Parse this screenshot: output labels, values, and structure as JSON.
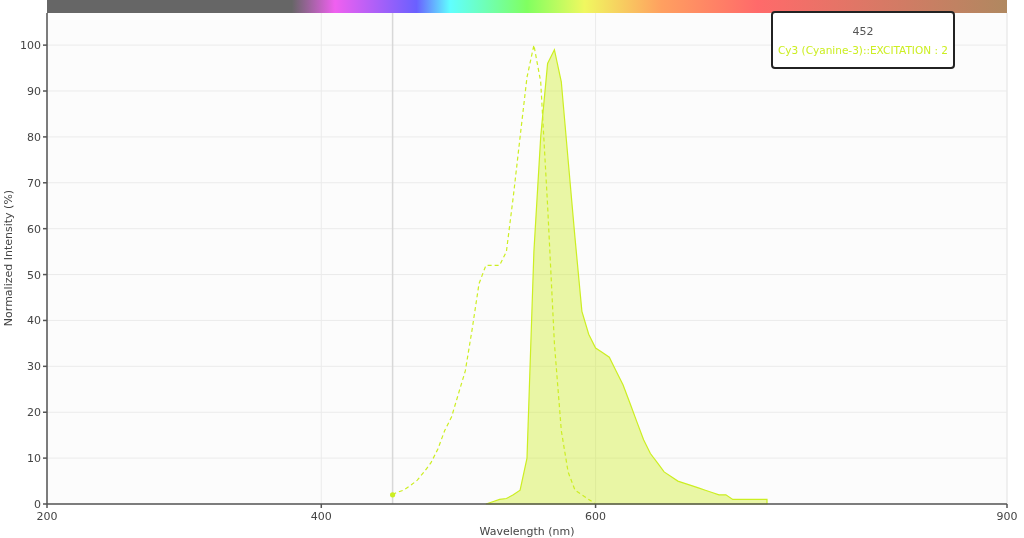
{
  "chart": {
    "chart_data": {
      "type": "area",
      "xlabel": "Wavelength (nm)",
      "ylabel": "Normalized Intensity (%)",
      "xlim": [
        200,
        900
      ],
      "ylim": [
        0,
        107
      ],
      "xticks": [
        200,
        400,
        600,
        900
      ],
      "yticks": [
        0,
        10,
        20,
        30,
        40,
        50,
        60,
        70,
        80,
        90,
        100
      ],
      "grid": true,
      "ref_lines": [
        {
          "axis": "x",
          "value": 452
        }
      ],
      "x": [
        452,
        455,
        460,
        465,
        470,
        475,
        480,
        485,
        490,
        495,
        500,
        505,
        510,
        515,
        520,
        525,
        530,
        535,
        540,
        545,
        550,
        555,
        560,
        565,
        570,
        575,
        580,
        585,
        590,
        595,
        600,
        605,
        610,
        615,
        620,
        625,
        630,
        635,
        640,
        645,
        650,
        655,
        660,
        665,
        670,
        675,
        680,
        685,
        690,
        695,
        700,
        705,
        710,
        715,
        720,
        725
      ],
      "series": [
        {
          "type": "line",
          "line_style": "dashed",
          "color": "#ccee22",
          "values": [
            2,
            2.5,
            3,
            4,
            5.2,
            7,
            9,
            12,
            16,
            19,
            24,
            29,
            38,
            48,
            52,
            52,
            52,
            55,
            67,
            80,
            93,
            100,
            92,
            65,
            35,
            16,
            7,
            3,
            2,
            1,
            0,
            null,
            null,
            null,
            null,
            null,
            null,
            null,
            null,
            null,
            null,
            null,
            null,
            null,
            null,
            null,
            null,
            null,
            null,
            null,
            null,
            null,
            null,
            null,
            null,
            null
          ]
        },
        {
          "type": "area",
          "color": "#ccee22",
          "values": [
            null,
            null,
            null,
            null,
            null,
            null,
            null,
            null,
            null,
            null,
            null,
            null,
            null,
            null,
            0,
            0.5,
            1,
            1.2,
            2,
            3,
            10,
            55,
            80,
            96,
            99,
            92,
            75,
            58,
            42,
            37,
            34,
            33,
            32,
            29,
            26,
            22,
            18,
            14,
            11,
            9,
            7,
            6,
            5,
            4.5,
            4,
            3.5,
            3,
            2.5,
            2,
            2,
            1,
            1,
            1,
            1,
            1,
            1
          ]
        }
      ]
    },
    "tooltip": {
      "title": "452",
      "text": "Cy3 (Cyanine-3)::EXCITATION : 2"
    }
  }
}
